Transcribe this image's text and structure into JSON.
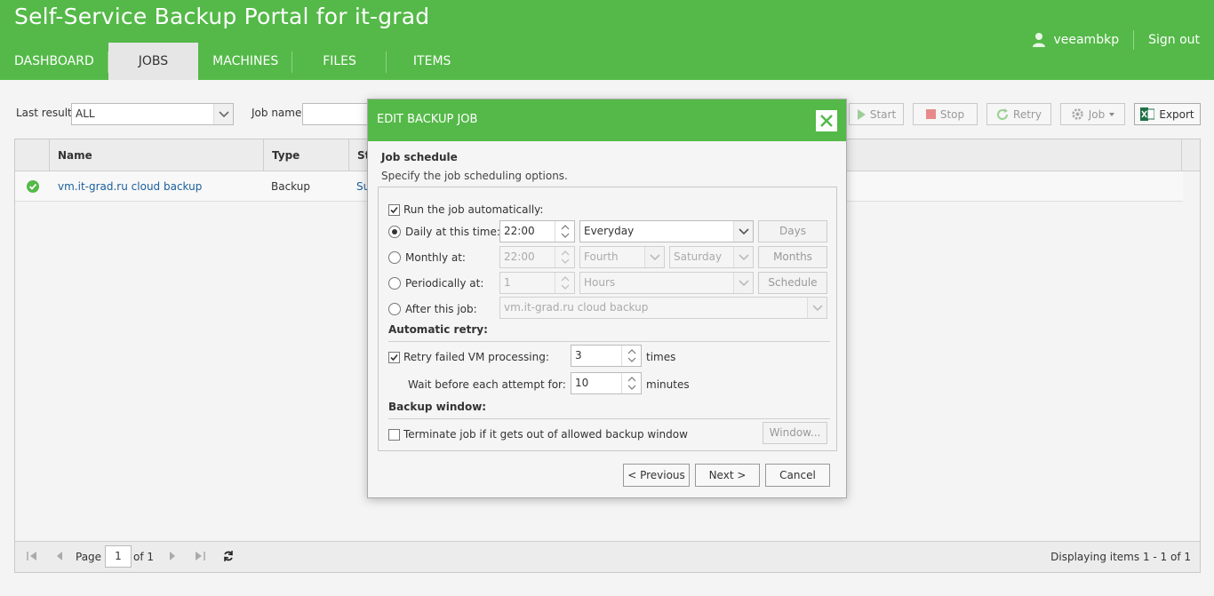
{
  "header": {
    "title": "Self-Service Backup Portal for it-grad",
    "user": "veeambkp",
    "signout": "Sign out",
    "nav": [
      "DASHBOARD",
      "JOBS",
      "MACHINES",
      "FILES",
      "ITEMS"
    ],
    "active_nav": "JOBS"
  },
  "toolbar": {
    "last_result_label": "Last result",
    "last_result_value": "ALL",
    "job_name_label": "Job name",
    "buttons": {
      "start": "Start",
      "stop": "Stop",
      "retry": "Retry",
      "job": "Job",
      "export": "Export"
    }
  },
  "grid": {
    "columns": [
      "Name",
      "Type",
      "St"
    ],
    "rows": [
      {
        "name": "vm.it-grad.ru cloud backup",
        "type": "Backup",
        "status": "Su"
      }
    ],
    "footer": {
      "page_label": "Page",
      "page_value": "1",
      "of_label": "of 1",
      "displaying": "Displaying items 1 - 1 of 1"
    }
  },
  "dialog": {
    "title": "EDIT BACKUP JOB",
    "section_title": "Job schedule",
    "section_subtitle": "Specify the job scheduling options.",
    "run_auto_label": "Run the job automatically:",
    "run_auto_checked": true,
    "daily": {
      "label": "Daily at this time:",
      "time": "22:00",
      "frequency": "Everyday",
      "button": "Days",
      "selected": true
    },
    "monthly": {
      "label": "Monthly at:",
      "time": "22:00",
      "week": "Fourth",
      "day": "Saturday",
      "button": "Months"
    },
    "periodically": {
      "label": "Periodically at:",
      "value": "1",
      "unit": "Hours",
      "button": "Schedule"
    },
    "after_job": {
      "label": "After this job:",
      "job": "vm.it-grad.ru cloud backup"
    },
    "auto_retry_title": "Automatic retry:",
    "retry_label": "Retry failed VM processing:",
    "retry_checked": true,
    "retry_value": "3",
    "retry_unit": "times",
    "wait_label": "Wait before each attempt for:",
    "wait_value": "10",
    "wait_unit": "minutes",
    "backup_window_title": "Backup window:",
    "terminate_label": "Terminate job if it gets out of allowed backup window",
    "terminate_checked": false,
    "window_button": "Window...",
    "previous": "< Previous",
    "next": "Next >",
    "cancel": "Cancel"
  }
}
